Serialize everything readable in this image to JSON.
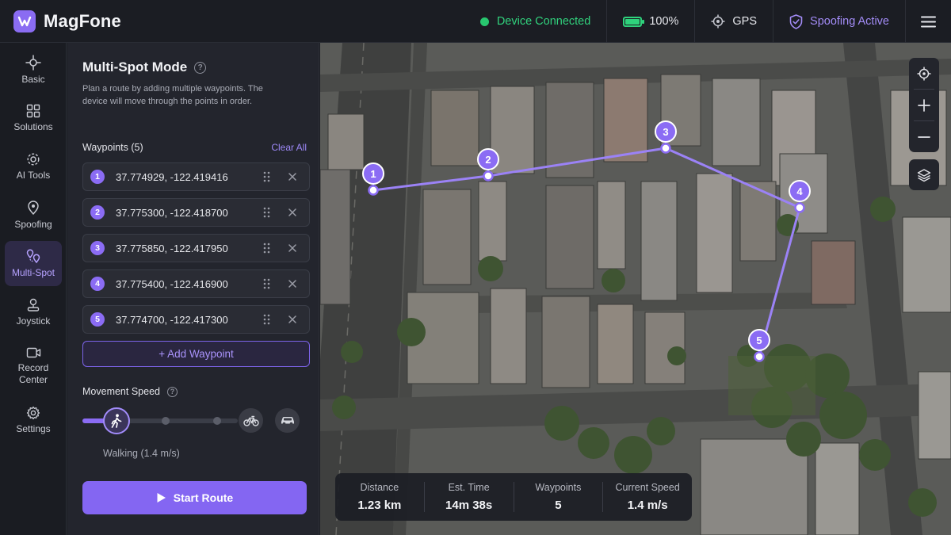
{
  "app": {
    "name": "MagFone"
  },
  "status": {
    "device": "Device Connected",
    "battery": "100%",
    "battery_level": 1.0,
    "gps": "GPS",
    "spoofing": "Spoofing Active"
  },
  "sidebar": {
    "items": [
      {
        "label": "Basic",
        "icon": "basic-icon"
      },
      {
        "label": "Solutions",
        "icon": "solutions-icon"
      },
      {
        "label": "AI Tools",
        "icon": "ai-tools-icon"
      },
      {
        "label": "Spoofing",
        "icon": "spoofing-icon"
      },
      {
        "label": "Multi-Spot",
        "icon": "multi-spot-icon",
        "active": true
      },
      {
        "label": "Joystick",
        "icon": "joystick-icon"
      },
      {
        "label": "Record Center",
        "icon": "record-center-icon"
      },
      {
        "label": "Settings",
        "icon": "settings-icon"
      }
    ]
  },
  "panel": {
    "title": "Multi-Spot Mode",
    "description": "Plan a route by adding multiple waypoints. The device will move through the points in order.",
    "waypoints_header": "Waypoints (5)",
    "clear_all": "Clear All",
    "waypoints": [
      {
        "num": "1",
        "coord": "37.774929, -122.419416"
      },
      {
        "num": "2",
        "coord": "37.775300, -122.418700"
      },
      {
        "num": "3",
        "coord": "37.775850, -122.417950"
      },
      {
        "num": "4",
        "coord": "37.775400, -122.416900"
      },
      {
        "num": "5",
        "coord": "37.774700, -122.417300"
      }
    ],
    "add_waypoint": "+ Add Waypoint",
    "speed_label": "Movement Speed",
    "speed_mode": "Walking (1.4 m/s)",
    "speed_level_fraction": 0.0,
    "start_route": "Start Route"
  },
  "map": {
    "route_color": "#9b82f6",
    "markers": [
      "1",
      "2",
      "3",
      "4",
      "5"
    ]
  },
  "stats": [
    {
      "label": "Distance",
      "value": "1.23 km"
    },
    {
      "label": "Est. Time",
      "value": "14m 38s"
    },
    {
      "label": "Waypoints",
      "value": "5"
    },
    {
      "label": "Current Speed",
      "value": "1.4 m/s"
    }
  ]
}
